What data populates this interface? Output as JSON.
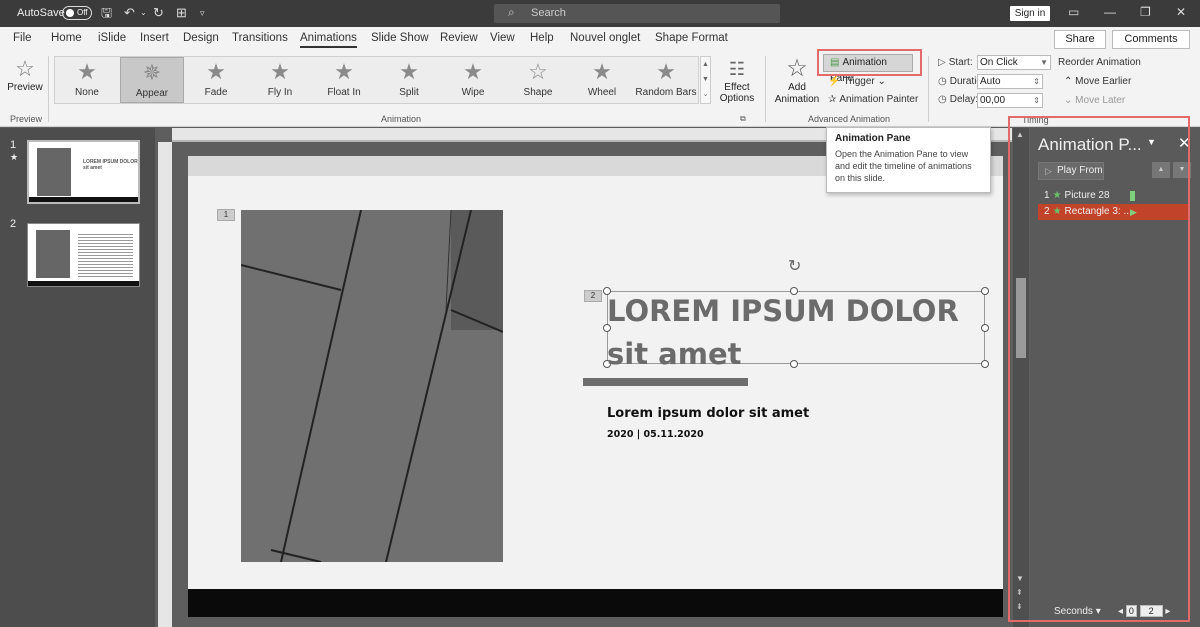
{
  "titlebar": {
    "autosave_label": "AutoSave",
    "autosave_state": "Off",
    "search_placeholder": "Search",
    "signin_label": "Sign in"
  },
  "menu": {
    "tabs": [
      "File",
      "Home",
      "iSlide",
      "Insert",
      "Design",
      "Transitions",
      "Animations",
      "Slide Show",
      "Review",
      "View",
      "Help",
      "Nouvel onglet",
      "Shape Format"
    ],
    "active_tab": "Animations",
    "share_label": "Share",
    "comments_label": "Comments"
  },
  "ribbon": {
    "preview": {
      "label": "Preview",
      "group_label": "Preview"
    },
    "animations": [
      "None",
      "Appear",
      "Fade",
      "Fly In",
      "Float In",
      "Split",
      "Wipe",
      "Shape",
      "Wheel",
      "Random Bars"
    ],
    "selected_animation": "Appear",
    "effect_options_label_1": "Effect",
    "effect_options_label_2": "Options",
    "animation_group_label": "Animation",
    "add_animation_label_1": "Add",
    "add_animation_label_2": "Animation",
    "animation_pane_label": "Animation Pane",
    "trigger_label": "Trigger",
    "animation_painter_label": "Animation Painter",
    "advanced_group_label": "Advanced Animation",
    "start_label": "Start:",
    "start_value": "On Click",
    "duration_label": "Duration:",
    "duration_value": "Auto",
    "delay_label": "Delay:",
    "delay_value": "00,00",
    "reorder_title": "Reorder Animation",
    "move_earlier_label": "Move Earlier",
    "move_later_label": "Move Later",
    "timing_group_label": "Timing"
  },
  "tooltip": {
    "title": "Animation Pane",
    "body": "Open the Animation Pane to view and edit the timeline of animations on this slide."
  },
  "thumbnails": {
    "slide1_num": "1",
    "slide1_star": "★",
    "slide1_title": "LOREM IPSUM DOLOR",
    "slide1_sub": "sit amet",
    "slide2_num": "2"
  },
  "slide": {
    "tag1": "1",
    "tag2": "2",
    "title": "LOREM IPSUM DOLOR sit amet",
    "subtitle": "Lorem ipsum dolor sit amet",
    "date": "2020 | 05.11.2020"
  },
  "animation_pane": {
    "title": "Animation P...",
    "play_from_label": "Play From",
    "items": [
      {
        "num": "1",
        "name": "Picture 28"
      },
      {
        "num": "2",
        "name": "Rectangle 3: ..."
      }
    ],
    "seconds_label": "Seconds",
    "scale_start": "0",
    "scale_end": "2"
  },
  "colors": {
    "highlight": "#e26a6a",
    "selected_item": "#c0432a",
    "star_green": "#6cc06c"
  }
}
